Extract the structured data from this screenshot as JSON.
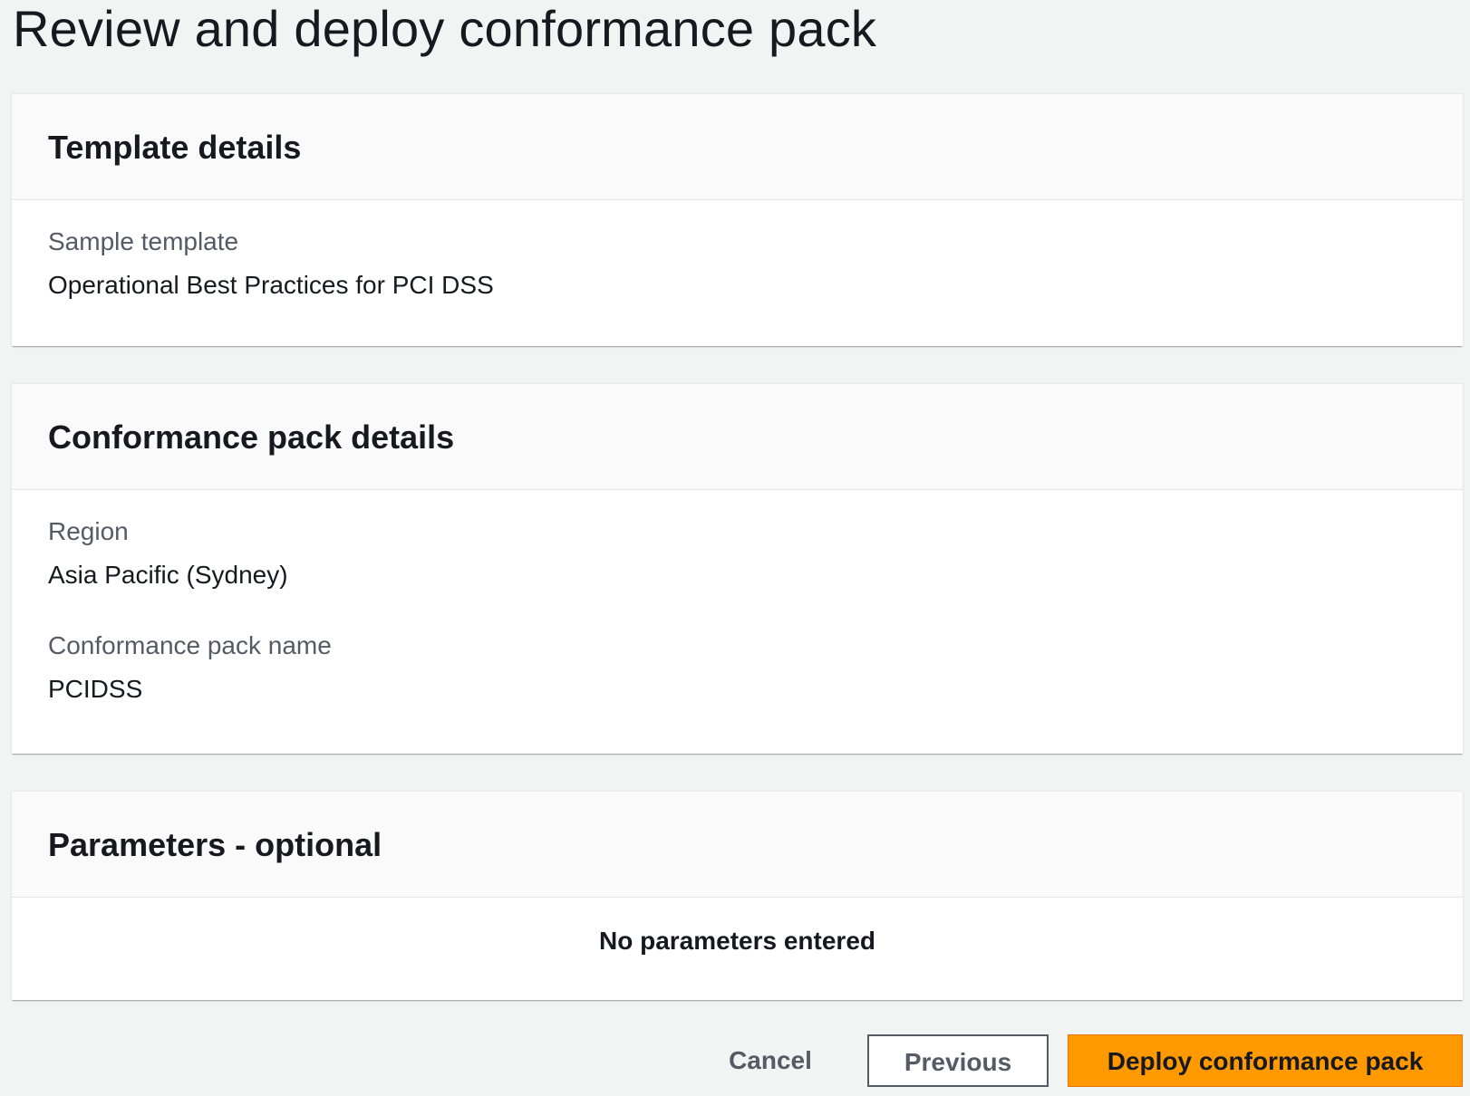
{
  "page": {
    "title": "Review and deploy conformance pack"
  },
  "template_details": {
    "title": "Template details",
    "sample_template_label": "Sample template",
    "sample_template_value": "Operational Best Practices for PCI DSS"
  },
  "conformance_pack_details": {
    "title": "Conformance pack details",
    "region_label": "Region",
    "region_value": "Asia Pacific (Sydney)",
    "name_label": "Conformance pack name",
    "name_value": "PCIDSS"
  },
  "parameters": {
    "title": "Parameters - optional",
    "empty_text": "No parameters entered"
  },
  "actions": {
    "cancel_label": "Cancel",
    "previous_label": "Previous",
    "deploy_label": "Deploy conformance pack"
  },
  "colors": {
    "background": "#f2f3f3",
    "primary_button": "#ff9900",
    "text_primary": "#16191f",
    "text_secondary": "#545b64"
  }
}
